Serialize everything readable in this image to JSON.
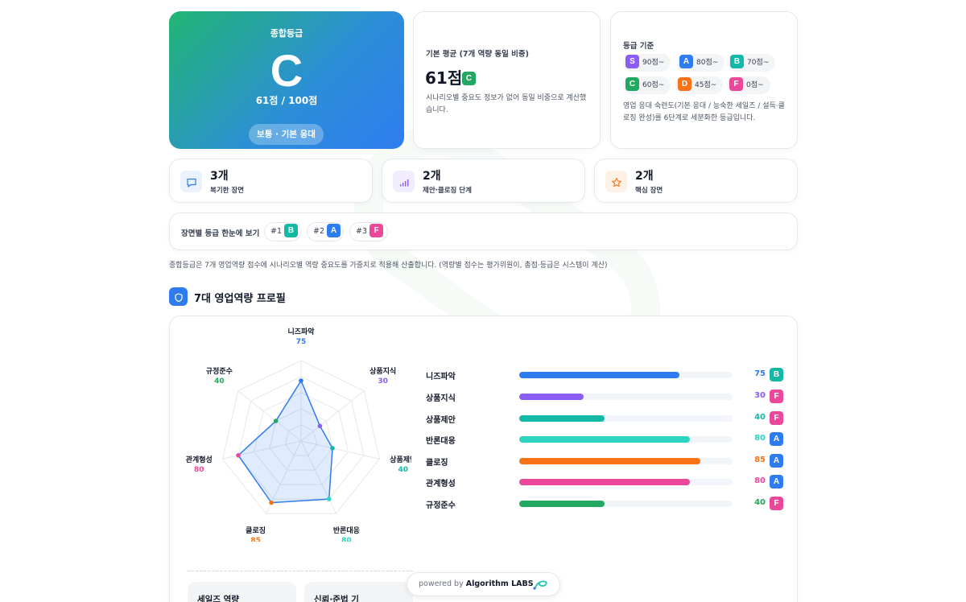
{
  "hero": {
    "label": "종합등급",
    "grade": "C",
    "score": "61점 / 100점",
    "level": "보통 · 기본 응대"
  },
  "average": {
    "title": "기본 평균 (7개 역량 동일 비중)",
    "score": "61점",
    "grade": "C",
    "desc": "시나리오별 중요도 정보가 없어 동일 비중으로 계산했습니다."
  },
  "standard": {
    "title": "등급 기준",
    "grades": [
      {
        "g": "S",
        "t": "90점~",
        "color": "#8b5cf6"
      },
      {
        "g": "A",
        "t": "80점~",
        "color": "#2f7cf0"
      },
      {
        "g": "B",
        "t": "70점~",
        "color": "#14b8a6"
      },
      {
        "g": "C",
        "t": "60점~",
        "color": "#22a861"
      },
      {
        "g": "D",
        "t": "45점~",
        "color": "#f97316"
      },
      {
        "g": "F",
        "t": "0점~",
        "color": "#ec4899"
      }
    ],
    "desc": "영업 응대 숙련도(기본 응대 / 능숙한 세일즈 / 설득·클로징 완성)를 6단계로 세분화한 등급입니다."
  },
  "stats": [
    {
      "num": "3개",
      "label": "복기한 장면",
      "icon": "chat-icon"
    },
    {
      "num": "2개",
      "label": "제안·클로징 단계",
      "icon": "signal-icon"
    },
    {
      "num": "2개",
      "label": "핵심 장면",
      "icon": "star-icon"
    }
  ],
  "scenes": {
    "label": "장면별 등급 한눈에 보기",
    "items": [
      {
        "no": "#1",
        "grade": "B",
        "color": "#14b8a6"
      },
      {
        "no": "#2",
        "grade": "A",
        "color": "#2f7cf0"
      },
      {
        "no": "#3",
        "grade": "F",
        "color": "#ec4899"
      }
    ]
  },
  "note": "종합등급은 7개 영업역량 점수에 시나리오별 역량 중요도를 가중치로 적용해 산출합니다. (역량별 점수는 평가위원이, 총점·등급은 시스템이 계산)",
  "section": {
    "title": "7대 영업역량 프로필",
    "icon": "shield-icon"
  },
  "chart_data": {
    "type": "radar",
    "max": 100,
    "categories": [
      "니즈파악",
      "상품지식",
      "상품제안",
      "반론대응",
      "클로징",
      "관계형성",
      "규정준수"
    ],
    "values": [
      75,
      30,
      40,
      80,
      85,
      80,
      40
    ],
    "grades": [
      "B",
      "F",
      "F",
      "A",
      "A",
      "A",
      "F"
    ],
    "colors": [
      "#2f7cf0",
      "#8b5cf6",
      "#14b8a6",
      "#2dd4bf",
      "#f97316",
      "#ec4899",
      "#22a861"
    ]
  },
  "subcards": [
    "세일즈 역량",
    "신뢰·준법 기"
  ],
  "powered": {
    "prefix": "powered by",
    "brand": "Algorithm LABS"
  }
}
